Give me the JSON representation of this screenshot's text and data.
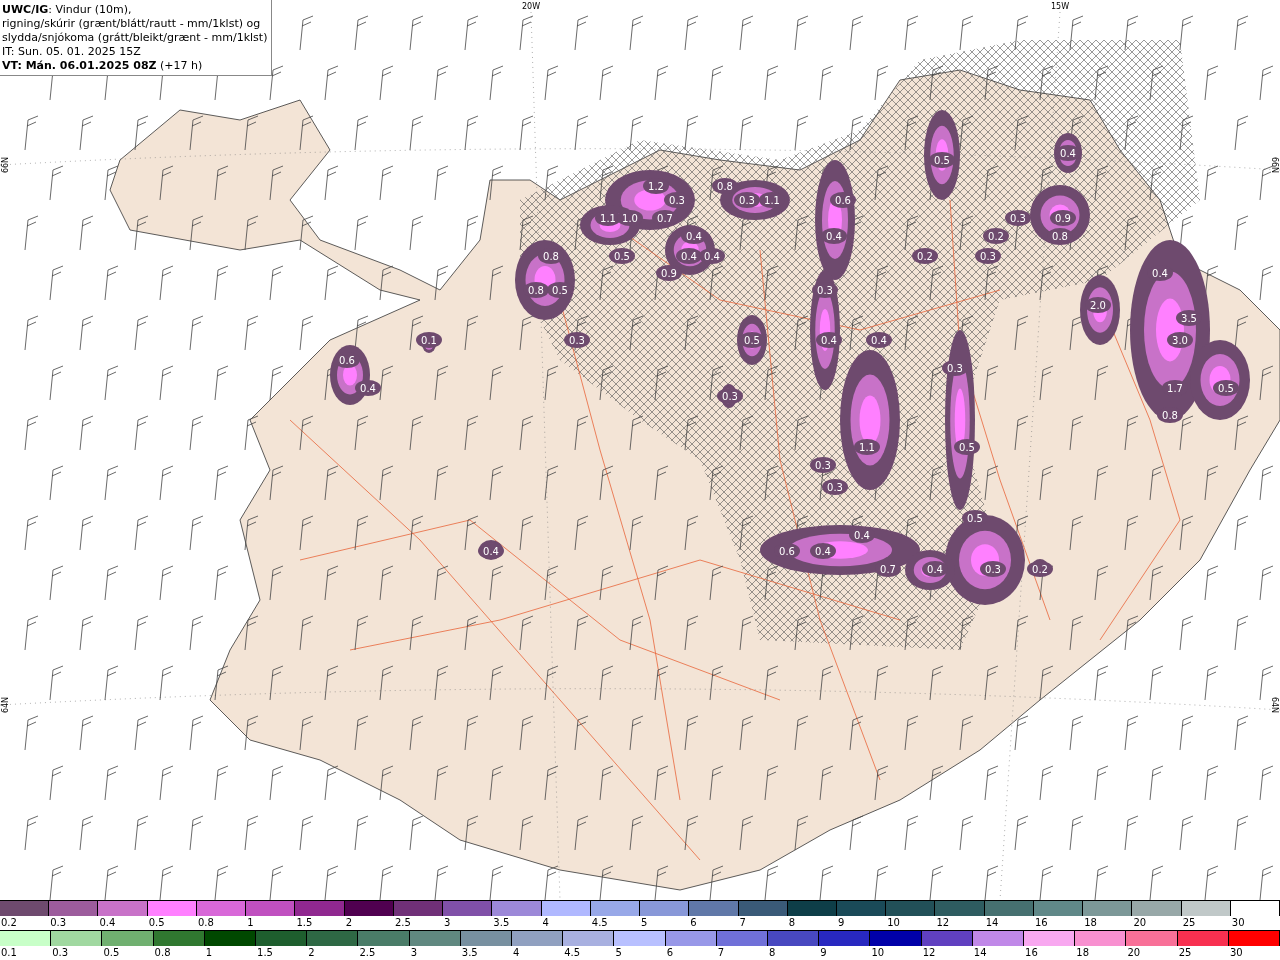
{
  "header": {
    "lines": [
      "**UWC/IG**: Vindur (10m),",
      "rigning/skúrir (grænt/blátt/rautt - mm/1klst) og",
      "slydda/snjókoma (grátt/bleikt/grænt - mm/1klst)",
      "IT: Sun. 05. 01. 2025 15Z",
      "**VT: Mán. 06.01.2025 08Z** (+17 h)"
    ]
  },
  "map": {
    "longitude_labels": [
      "20W",
      "15W"
    ],
    "latitude_labels_left": [
      "66N",
      "64N"
    ],
    "latitude_labels_right": [
      "66N",
      "64N"
    ],
    "values": [
      "0.4",
      "0.5",
      "1.2",
      "0.8",
      "0.3",
      "0.3",
      "1.1",
      "0.6",
      "1.1",
      "1.0",
      "0.7",
      "0.3",
      "0.9",
      "0.4",
      "0.4",
      "0.2",
      "0.8",
      "0.8",
      "0.5",
      "0.4",
      "0.4",
      "0.2",
      "0.3",
      "0.9",
      "0.4",
      "0.8",
      "0.5",
      "0.3",
      "2.0",
      "3.5",
      "0.1",
      "0.3",
      "0.5",
      "0.4",
      "0.4",
      "3.0",
      "0.6",
      "0.3",
      "0.4",
      "1.7",
      "0.5",
      "0.3",
      "0.8",
      "1.1",
      "0.5",
      "0.3",
      "0.3",
      "0.5",
      "0.4",
      "0.4",
      "0.6",
      "0.4",
      "0.7",
      "0.4",
      "0.3",
      "0.2"
    ]
  },
  "colorbars": [
    {
      "swatches": [
        {
          "color": "#6e4a6e",
          "label": "0.2"
        },
        {
          "color": "#9c5c9c",
          "label": "0.3"
        },
        {
          "color": "#c872c8",
          "label": "0.4"
        },
        {
          "color": "#ff80ff",
          "label": "0.5"
        },
        {
          "color": "#d868d8",
          "label": "0.8"
        },
        {
          "color": "#c050c0",
          "label": "1"
        },
        {
          "color": "#902890",
          "label": "1.5"
        },
        {
          "color": "#500050",
          "label": "2"
        },
        {
          "color": "#703078",
          "label": "2.5"
        },
        {
          "color": "#8050a8",
          "label": "3"
        },
        {
          "color": "#9c88d8",
          "label": "3.5"
        },
        {
          "color": "#b0b8ff",
          "label": "4"
        },
        {
          "color": "#98a8e8",
          "label": "4.5"
        },
        {
          "color": "#8898d8",
          "label": "5"
        },
        {
          "color": "#6078a8",
          "label": "6"
        },
        {
          "color": "#3a5a78",
          "label": "7"
        },
        {
          "color": "#0e3e48",
          "label": "8"
        },
        {
          "color": "#1a4a58",
          "label": "9"
        },
        {
          "color": "#225058",
          "label": "10"
        },
        {
          "color": "#2e5c60",
          "label": "12"
        },
        {
          "color": "#467070",
          "label": "14"
        },
        {
          "color": "#608888",
          "label": "16"
        },
        {
          "color": "#7c9898",
          "label": "18"
        },
        {
          "color": "#98a8a8",
          "label": "20"
        },
        {
          "color": "#c0c8c8",
          "label": "25"
        },
        {
          "color": "#ffffff",
          "label": "30"
        }
      ]
    },
    {
      "swatches": [
        {
          "color": "#c8ffc8",
          "label": "0.1"
        },
        {
          "color": "#a0d8a0",
          "label": "0.3"
        },
        {
          "color": "#70b070",
          "label": "0.5"
        },
        {
          "color": "#307830",
          "label": "0.8"
        },
        {
          "color": "#004800",
          "label": "1"
        },
        {
          "color": "#1e5e2e",
          "label": "1.5"
        },
        {
          "color": "#2e6844",
          "label": "2"
        },
        {
          "color": "#4a7c68",
          "label": "2.5"
        },
        {
          "color": "#608880",
          "label": "3"
        },
        {
          "color": "#7890a0",
          "label": "3.5"
        },
        {
          "color": "#90a0c0",
          "label": "4"
        },
        {
          "color": "#a8b0e0",
          "label": "4.5"
        },
        {
          "color": "#b8c0ff",
          "label": "5"
        },
        {
          "color": "#9898e8",
          "label": "6"
        },
        {
          "color": "#7070d8",
          "label": "7"
        },
        {
          "color": "#4848c0",
          "label": "8"
        },
        {
          "color": "#2828c0",
          "label": "9"
        },
        {
          "color": "#0000a8",
          "label": "10"
        },
        {
          "color": "#6040c0",
          "label": "12"
        },
        {
          "color": "#c088e8",
          "label": "14"
        },
        {
          "color": "#f8a8f0",
          "label": "16"
        },
        {
          "color": "#f890d0",
          "label": "18"
        },
        {
          "color": "#f87098",
          "label": "20"
        },
        {
          "color": "#f83050",
          "label": "25"
        },
        {
          "color": "#ff0000",
          "label": "30"
        }
      ]
    }
  ]
}
